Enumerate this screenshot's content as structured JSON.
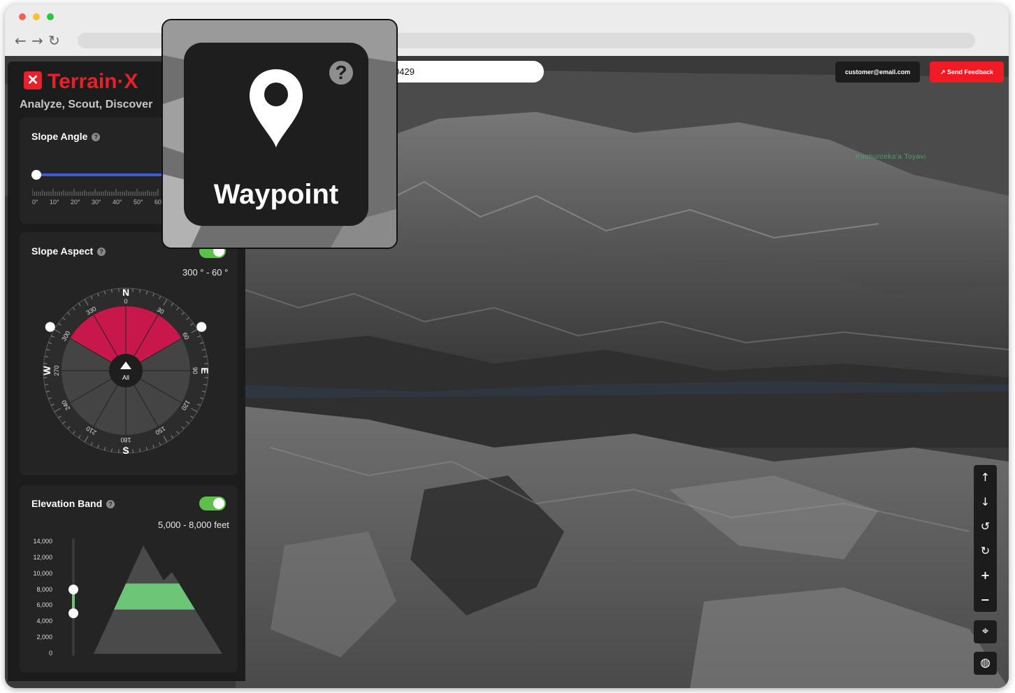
{
  "browser": {
    "window_dots": [
      "#ff5f57",
      "#febc2e",
      "#28c840"
    ]
  },
  "app": {
    "close_glyph": "✕",
    "brand": "Terrain·X",
    "tagline": "Analyze, Scout, Discover"
  },
  "slope_angle": {
    "title": "Slope Angle",
    "help": "?",
    "ticks": [
      "0°",
      "10°",
      "20°",
      "30°",
      "40°",
      "50°",
      "60"
    ]
  },
  "slope_aspect": {
    "title": "Slope Aspect",
    "help": "?",
    "enabled": true,
    "range_text": "300 ° - 60 °",
    "cardinals": {
      "n": "N",
      "s": "S",
      "e": "E",
      "w": "W"
    },
    "degree_labels": [
      "0",
      "30",
      "60",
      "90",
      "120",
      "150",
      "180",
      "210",
      "240",
      "270",
      "300",
      "330"
    ],
    "center_label": "All",
    "selected_start_deg": 300,
    "selected_end_deg": 60
  },
  "elevation_band": {
    "title": "Elevation Band",
    "help": "?",
    "enabled": true,
    "range_text": "5,000 - 8,000 feet",
    "axis_labels": [
      "14,000",
      "12,000",
      "10,000",
      "8,000",
      "6,000",
      "4,000",
      "2,000",
      "0"
    ],
    "band_low_ft": 5000,
    "band_high_ft": 8000,
    "axis_max_ft": 14000
  },
  "search": {
    "value": "0429"
  },
  "header": {
    "account_email": "customer@email.com",
    "feedback_label": "Send Feedback",
    "feedback_icon": "↗"
  },
  "map": {
    "place_label": "Kuchunteka'a Toyavi"
  },
  "controls": {
    "up": "↑",
    "down": "↓",
    "rotate_left": "↺",
    "rotate_right": "↻",
    "zoom_in": "+",
    "zoom_out": "−",
    "locate": "⌖",
    "globe": "◍"
  },
  "popup": {
    "title": "Waypoint",
    "help": "?"
  },
  "colors": {
    "brand_red": "#e8202a",
    "aspect_selected": "#c8174a",
    "band_green": "#6dc676",
    "toggle_on": "#5ec04a",
    "slider_blue": "#3b5bdb"
  }
}
